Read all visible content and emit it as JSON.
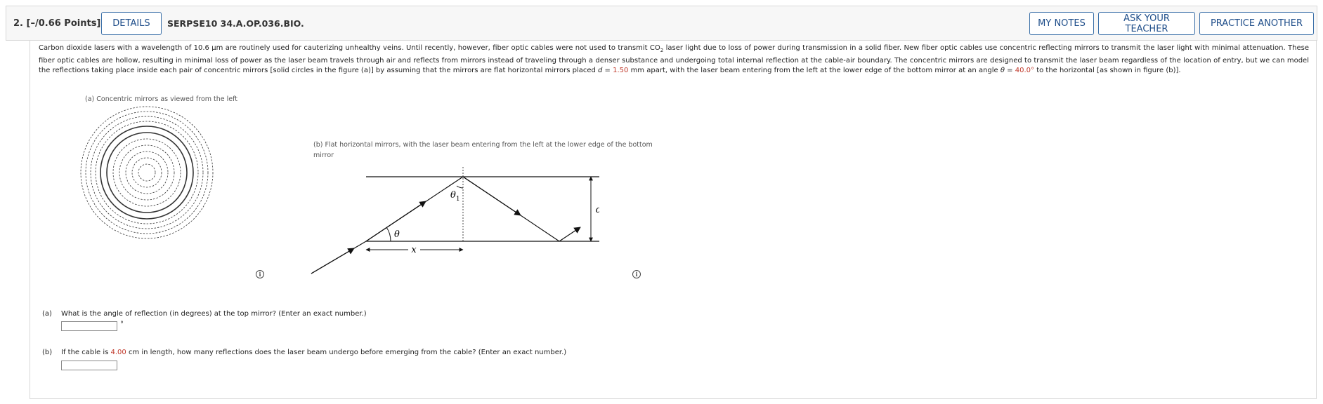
{
  "header": {
    "question_number": "2.",
    "points": "[–/0.66 Points]",
    "details_label": "DETAILS",
    "reference": "SERPSE10 34.A.OP.036.BIO.",
    "my_notes_label": "MY NOTES",
    "ask_teacher_label": "ASK YOUR TEACHER",
    "practice_label": "PRACTICE ANOTHER"
  },
  "problem": {
    "part1": "Carbon dioxide lasers with a wavelength of 10.6 µm are routinely used for cauterizing unhealthy veins. Until recently, however, fiber optic cables were not used to transmit CO",
    "co2_subscript": "2",
    "part2": " laser light due to loss of power during transmission in a solid fiber. New fiber optic cables use concentric reflecting mirrors to transmit the laser light with minimal attenuation. These fiber optic cables are hollow, resulting in minimal loss of power as the laser beam travels through air and reflects from mirrors instead of traveling through a denser substance and undergoing total internal reflection at the cable-air boundary. The concentric mirrors are designed to transmit the laser beam regardless of the location of entry, but we can model the reflections taking place inside each pair of concentric mirrors [solid circles in the figure (a)] by assuming that the mirrors are flat horizontal mirrors placed ",
    "d_symbol": "d",
    "eq1": " = ",
    "d_value": "1.50",
    "part3": " mm apart, with the laser beam entering from the left at the lower edge of the bottom mirror at an angle ",
    "theta_symbol": "θ",
    "eq2": " = ",
    "theta_value": "40.0°",
    "part4": " to the horizontal [as shown in figure (b)]."
  },
  "figure_a": {
    "caption": "(a) Concentric mirrors as viewed from the left"
  },
  "figure_b": {
    "caption_line1": "(b) Flat horizontal mirrors, with the laser beam entering from the left at the lower edge of the bottom",
    "caption_line2": "mirror",
    "label_theta1": "θ",
    "label_theta1_sub": "1",
    "label_theta": "θ",
    "label_d": "d",
    "label_x": "x"
  },
  "info_icon_glyph": "i",
  "question_a": {
    "label": "(a)",
    "text": "What is the angle of reflection (in degrees) at the top mirror? (Enter an exact number.)",
    "unit": "°",
    "value": ""
  },
  "question_b": {
    "label": "(b)",
    "text_prefix": "If the cable is ",
    "length_value": "4.00",
    "text_suffix": " cm in length, how many reflections does the laser beam undergo before emerging from the cable? (Enter an exact number.)",
    "value": ""
  },
  "colors": {
    "accent_button": "#1f4e8a",
    "red_value": "#c0392b"
  }
}
